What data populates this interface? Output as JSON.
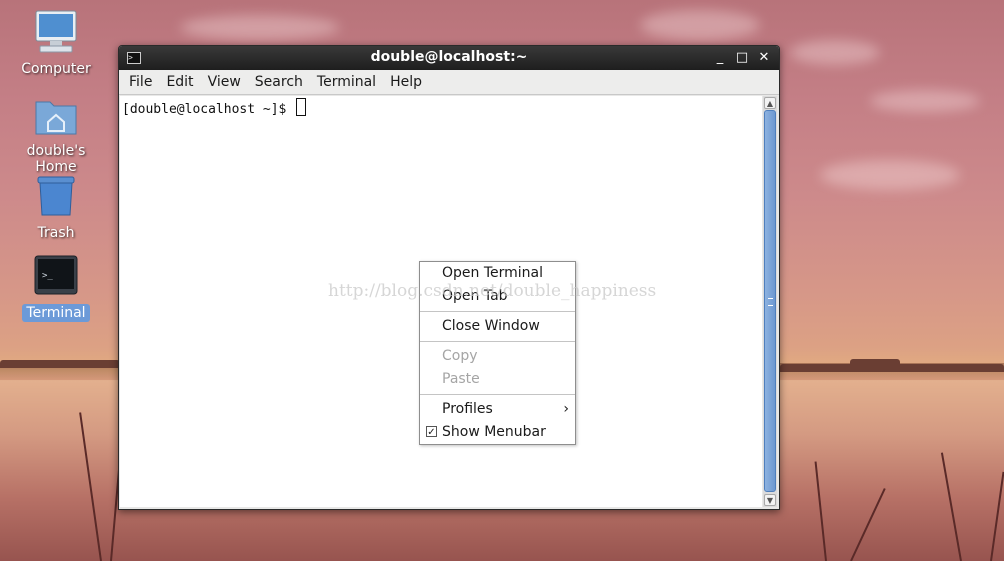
{
  "desktop": {
    "icons": [
      {
        "label": "Computer"
      },
      {
        "label": "double's Home"
      },
      {
        "label": "Trash"
      },
      {
        "label": "Terminal"
      }
    ]
  },
  "window": {
    "title": "double@localhost:~",
    "controls": {
      "minimize": "_",
      "maximize": "□",
      "close": "✕"
    },
    "menubar": [
      "File",
      "Edit",
      "View",
      "Search",
      "Terminal",
      "Help"
    ],
    "prompt": "[double@localhost ~]$ "
  },
  "context_menu": {
    "open_terminal": "Open Terminal",
    "open_tab": "Open Tab",
    "close_window": "Close Window",
    "copy": "Copy",
    "paste": "Paste",
    "profiles": "Profiles",
    "show_menubar": "Show Menubar",
    "show_menubar_checked": true
  },
  "watermark": "http://blog.csdn.net/double_happiness",
  "colors": {
    "titlebar": "#2a2a2a",
    "selection": "#6c9ad8",
    "scroll_thumb": "#7aa3d8"
  }
}
